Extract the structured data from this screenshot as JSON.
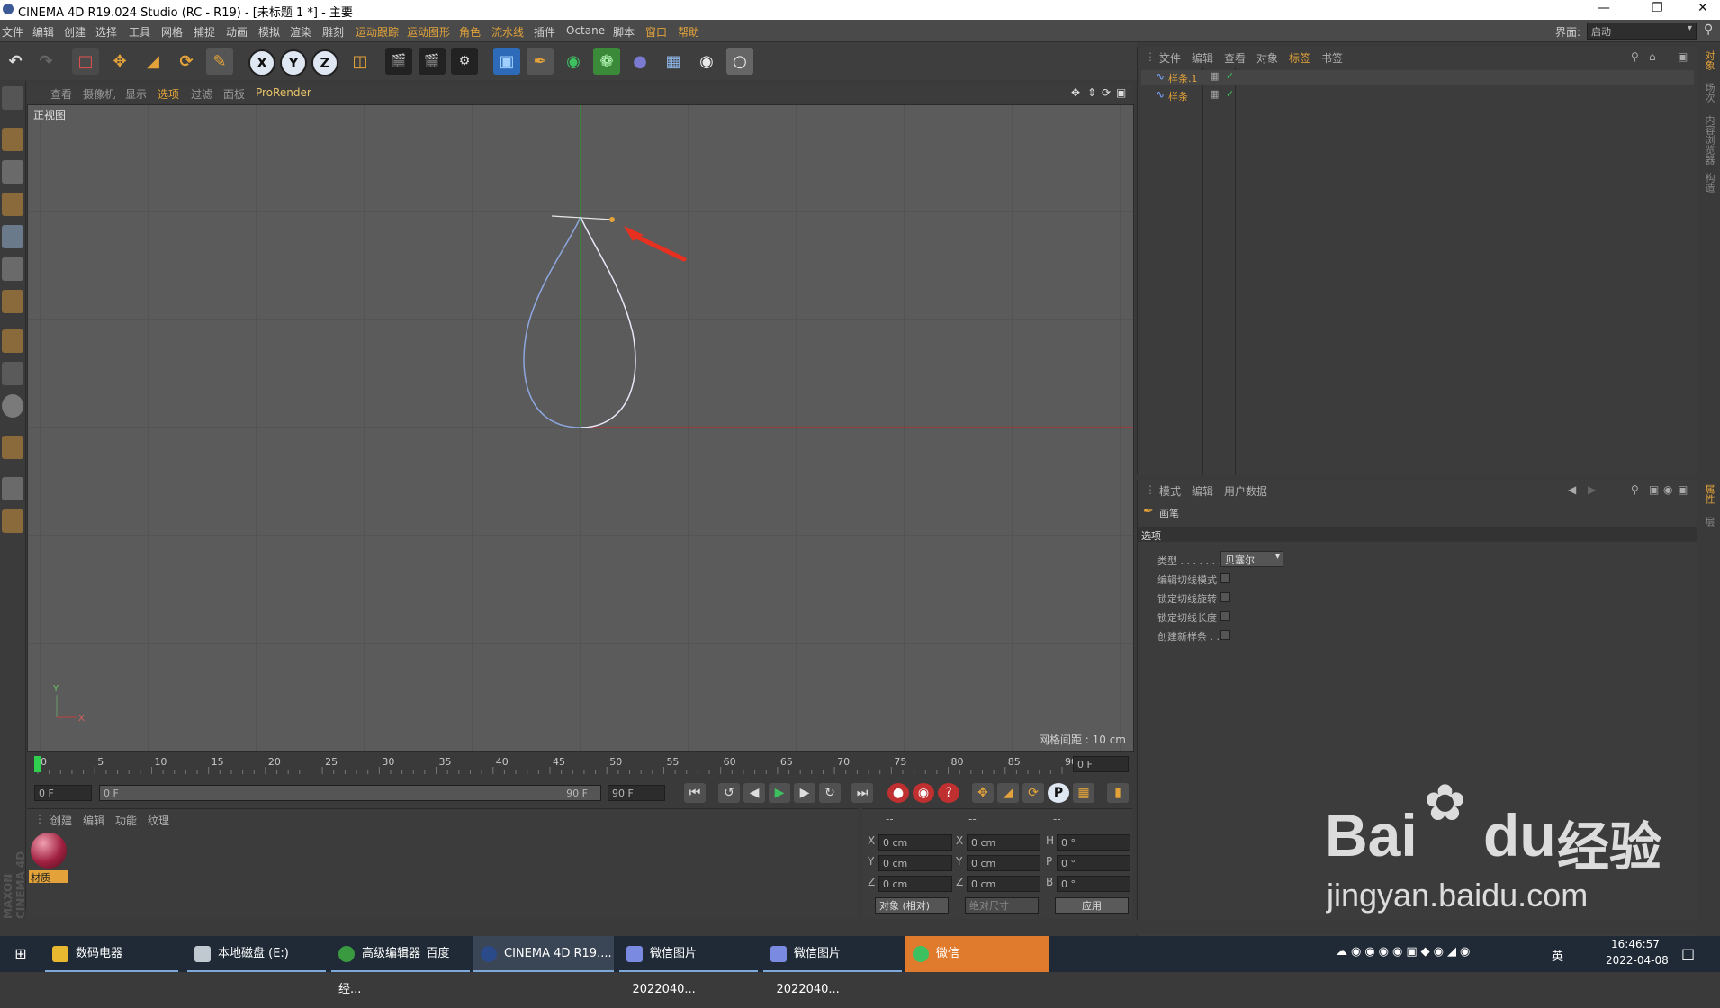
{
  "window": {
    "title": "CINEMA 4D R19.024 Studio (RC - R19) - [未标题 1 *] - 主要"
  },
  "menu": [
    {
      "label": "文件"
    },
    {
      "label": "编辑"
    },
    {
      "label": "创建"
    },
    {
      "label": "选择"
    },
    {
      "label": "工具"
    },
    {
      "label": "网格"
    },
    {
      "label": "捕捉"
    },
    {
      "label": "动画"
    },
    {
      "label": "模拟"
    },
    {
      "label": "渲染"
    },
    {
      "label": "雕刻"
    },
    {
      "label": "运动跟踪"
    },
    {
      "label": "运动图形"
    },
    {
      "label": "角色"
    },
    {
      "label": "流水线"
    },
    {
      "label": "插件"
    },
    {
      "label": "Octane"
    },
    {
      "label": "脚本"
    },
    {
      "label": "窗口"
    },
    {
      "label": "帮助"
    }
  ],
  "layout": {
    "label": "界面:",
    "value": "启动"
  },
  "toolbar_icons": [
    "undo-icon",
    "redo-icon",
    "select-icon",
    "move-icon",
    "scale-icon",
    "rotate-icon",
    "pen-icon",
    "x-axis-icon",
    "y-axis-icon",
    "z-axis-icon",
    "coordinate-system-icon",
    "render-view-icon",
    "render-picture-queue-icon",
    "render-settings-icon",
    "cube-icon",
    "pen-spline-icon",
    "subdivision-icon",
    "cloner-icon",
    "deformer-icon",
    "floor-icon",
    "camera-icon",
    "light-icon"
  ],
  "axis_buttons": [
    "X",
    "Y",
    "Z"
  ],
  "viewport": {
    "menu": [
      "查看",
      "摄像机",
      "显示",
      "选项",
      "过滤",
      "面板",
      "ProRender"
    ],
    "active_menu": "选项",
    "view_name": "正视图",
    "grid_spacing": "网格间距 : 10 cm",
    "axis_x": "X",
    "axis_y": "Y"
  },
  "timeline": {
    "ticks": [
      "0",
      "5",
      "10",
      "15",
      "20",
      "25",
      "30",
      "35",
      "40",
      "45",
      "50",
      "55",
      "60",
      "65",
      "70",
      "75",
      "80",
      "85",
      "90"
    ],
    "current_frame": "0 F"
  },
  "transport": {
    "start": "0 F",
    "range_start": "0 F",
    "range_end": "90 F",
    "end": "90 F",
    "record_mode": "P"
  },
  "materials": {
    "menu": [
      "创建",
      "编辑",
      "功能",
      "纹理"
    ],
    "items": [
      {
        "label": "材质"
      }
    ]
  },
  "coordinates": {
    "headers": [
      "--",
      "--",
      "--"
    ],
    "rows": [
      {
        "axis": "X",
        "pos": "0 cm",
        "axis2": "X",
        "size": "0 cm",
        "rot_label": "H",
        "rot": "0 °"
      },
      {
        "axis": "Y",
        "pos": "0 cm",
        "axis2": "Y",
        "size": "0 cm",
        "rot_label": "P",
        "rot": "0 °"
      },
      {
        "axis": "Z",
        "pos": "0 cm",
        "axis2": "Z",
        "size": "0 cm",
        "rot_label": "B",
        "rot": "0 °"
      }
    ],
    "mode": "对象 (相对)",
    "size_mode": "绝对尺寸",
    "apply": "应用"
  },
  "object_manager": {
    "menu": [
      "文件",
      "编辑",
      "查看",
      "对象",
      "标签",
      "书签"
    ],
    "active_menu": "标签",
    "objects": [
      {
        "name": "样条.1"
      },
      {
        "name": "样条"
      }
    ]
  },
  "attribute_manager": {
    "menu": [
      "模式",
      "编辑",
      "用户数据"
    ],
    "tool_name": "画笔",
    "section": "选项",
    "type_label": "类型 . . . . . . .",
    "type_value": "贝塞尔",
    "options": [
      {
        "label": "编辑切线模式"
      },
      {
        "label": "锁定切线旋转"
      },
      {
        "label": "锁定切线长度"
      },
      {
        "label": "创建新样条 . ."
      }
    ]
  },
  "right_tabs": [
    "对象",
    "场次",
    "内容浏览器",
    "构造"
  ],
  "right_tabs2": [
    "属性",
    "层"
  ],
  "maxon_label": "MAXON CINEMA 4D",
  "taskbar": {
    "items": [
      {
        "label": "数码电器",
        "icon": "folder-icon"
      },
      {
        "label": "本地磁盘 (E:)",
        "icon": "drive-icon"
      },
      {
        "label": "高级编辑器_百度经...",
        "icon": "chrome-icon"
      },
      {
        "label": "CINEMA 4D R19....",
        "icon": "c4d-icon"
      },
      {
        "label": "微信图片_2022040...",
        "icon": "photo-icon"
      },
      {
        "label": "微信图片_2022040...",
        "icon": "photo-icon"
      },
      {
        "label": "微信",
        "icon": "wechat-icon"
      }
    ],
    "ime": "英",
    "ime2": "英",
    "time": "16:46:57",
    "date": "2022-04-08"
  },
  "watermark": {
    "brand": "Bai",
    "brand2": "du",
    "cn": "经验",
    "url": "jingyan.baidu.com"
  },
  "colors": {
    "accent": "#e3a33a",
    "viewport_bg": "#5b5b5b",
    "grid": "#4e4e4e",
    "x_axis": "#d02020",
    "y_axis": "#20a020",
    "spline": "#e8e8f8",
    "arrow": "#e83020"
  }
}
